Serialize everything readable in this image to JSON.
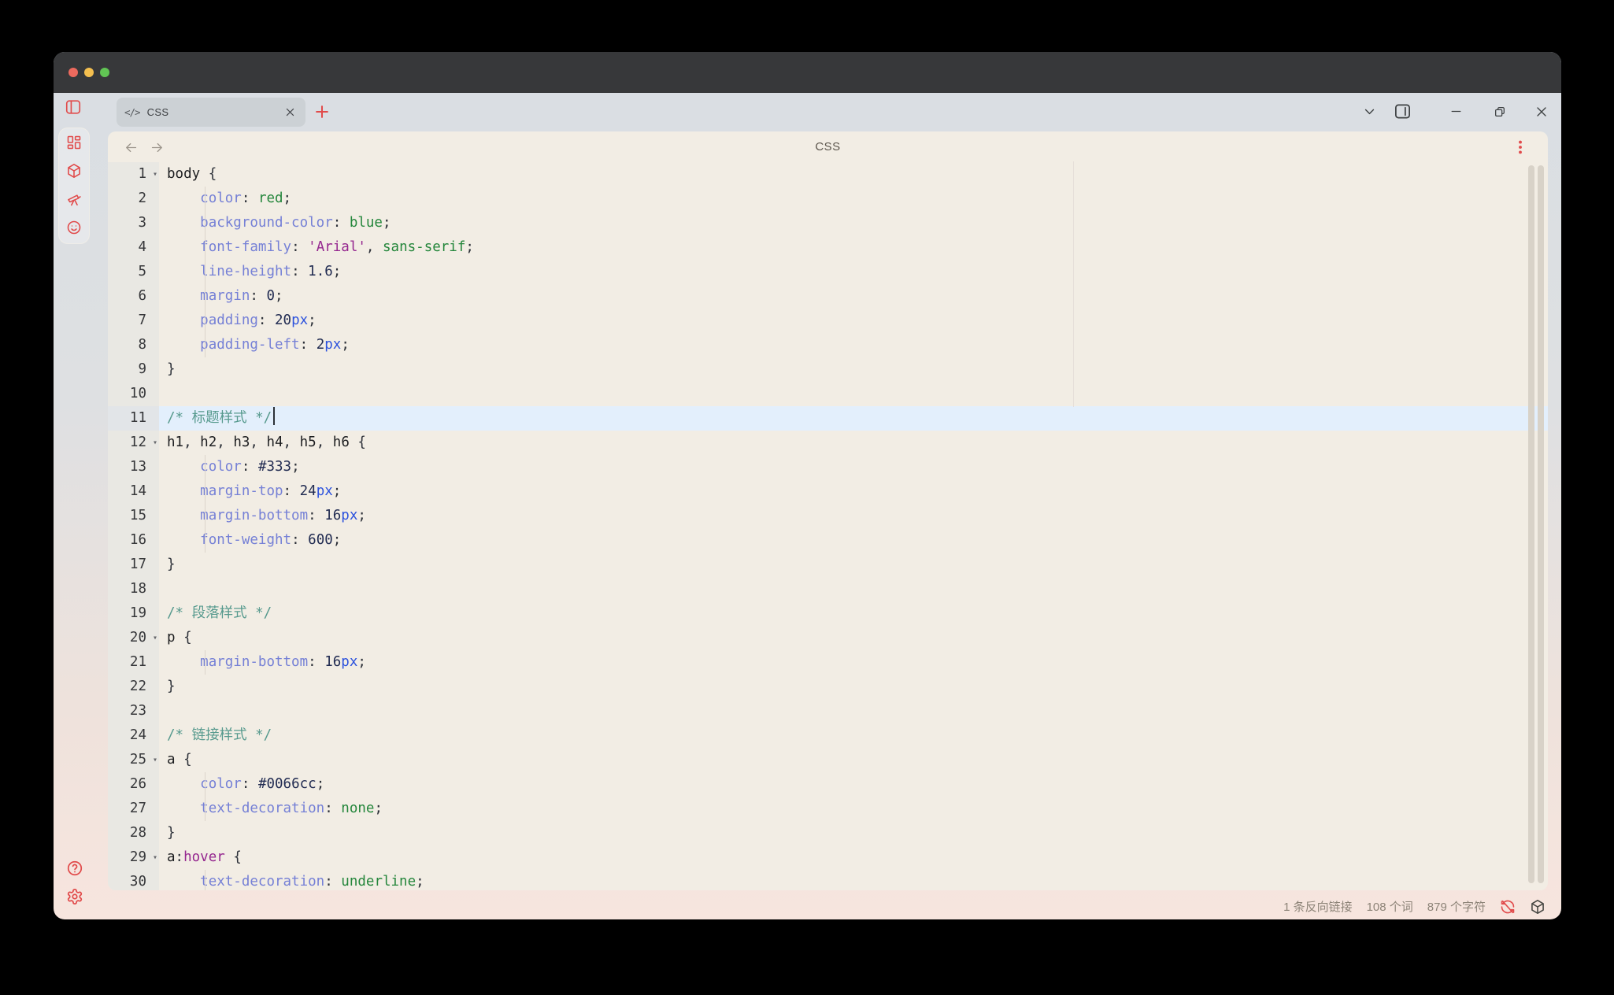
{
  "colors": {
    "accent": "#e14b4b",
    "titlebar": "#37383a",
    "editor_bg": "#f2ede4",
    "active_line": "#e3effc",
    "traffic_lights": [
      "#ed6a5e",
      "#f4bf4f",
      "#61c554"
    ]
  },
  "tabbar": {
    "tab": {
      "code_glyph": "</>",
      "label": "CSS"
    },
    "new_tab_label": "+"
  },
  "header": {
    "title": "CSS"
  },
  "editor": {
    "fold_marker": "▾",
    "token_colors": {
      "prop": "#7580d6",
      "kw": "#24863b",
      "str": "#95278f",
      "num": "#222c52",
      "unit": "#2c52dd",
      "comment": "#579a8e",
      "sel": "#1d1e20",
      "punct": "#2c3038",
      "pseudo": "#95278f"
    },
    "active_line_number": 11,
    "lines": [
      {
        "n": 1,
        "fold": true,
        "seg": [
          [
            "body",
            "sel"
          ],
          [
            " {",
            "punct"
          ]
        ]
      },
      {
        "n": 2,
        "seg": [
          [
            "    ",
            "plain"
          ],
          [
            "color",
            "prop"
          ],
          [
            ":",
            "punct"
          ],
          [
            " ",
            "plain"
          ],
          [
            "red",
            "kw"
          ],
          [
            ";",
            "punct"
          ]
        ]
      },
      {
        "n": 3,
        "seg": [
          [
            "    ",
            "plain"
          ],
          [
            "background-color",
            "prop"
          ],
          [
            ":",
            "punct"
          ],
          [
            " ",
            "plain"
          ],
          [
            "blue",
            "kw"
          ],
          [
            ";",
            "punct"
          ]
        ]
      },
      {
        "n": 4,
        "seg": [
          [
            "    ",
            "plain"
          ],
          [
            "font-family",
            "prop"
          ],
          [
            ":",
            "punct"
          ],
          [
            " ",
            "plain"
          ],
          [
            "'Arial'",
            "str"
          ],
          [
            ",",
            "punct"
          ],
          [
            " ",
            "plain"
          ],
          [
            "sans-serif",
            "kw"
          ],
          [
            ";",
            "punct"
          ]
        ]
      },
      {
        "n": 5,
        "seg": [
          [
            "    ",
            "plain"
          ],
          [
            "line-height",
            "prop"
          ],
          [
            ":",
            "punct"
          ],
          [
            " ",
            "plain"
          ],
          [
            "1.6",
            "num"
          ],
          [
            ";",
            "punct"
          ]
        ]
      },
      {
        "n": 6,
        "seg": [
          [
            "    ",
            "plain"
          ],
          [
            "margin",
            "prop"
          ],
          [
            ":",
            "punct"
          ],
          [
            " ",
            "plain"
          ],
          [
            "0",
            "num"
          ],
          [
            ";",
            "punct"
          ]
        ]
      },
      {
        "n": 7,
        "seg": [
          [
            "    ",
            "plain"
          ],
          [
            "padding",
            "prop"
          ],
          [
            ":",
            "punct"
          ],
          [
            " ",
            "plain"
          ],
          [
            "20",
            "num"
          ],
          [
            "px",
            "unit"
          ],
          [
            ";",
            "punct"
          ]
        ]
      },
      {
        "n": 8,
        "seg": [
          [
            "    ",
            "plain"
          ],
          [
            "padding-left",
            "prop"
          ],
          [
            ":",
            "punct"
          ],
          [
            " ",
            "plain"
          ],
          [
            "2",
            "num"
          ],
          [
            "px",
            "unit"
          ],
          [
            ";",
            "punct"
          ]
        ]
      },
      {
        "n": 9,
        "seg": [
          [
            "}",
            "punct"
          ]
        ]
      },
      {
        "n": 10,
        "seg": []
      },
      {
        "n": 11,
        "active": true,
        "cursor": true,
        "seg": [
          [
            "/* 标题样式 */",
            "comment"
          ]
        ]
      },
      {
        "n": 12,
        "fold": true,
        "seg": [
          [
            "h1",
            "sel"
          ],
          [
            ", ",
            "punct"
          ],
          [
            "h2",
            "sel"
          ],
          [
            ", ",
            "punct"
          ],
          [
            "h3",
            "sel"
          ],
          [
            ", ",
            "punct"
          ],
          [
            "h4",
            "sel"
          ],
          [
            ", ",
            "punct"
          ],
          [
            "h5",
            "sel"
          ],
          [
            ", ",
            "punct"
          ],
          [
            "h6",
            "sel"
          ],
          [
            " {",
            "punct"
          ]
        ]
      },
      {
        "n": 13,
        "seg": [
          [
            "    ",
            "plain"
          ],
          [
            "color",
            "prop"
          ],
          [
            ":",
            "punct"
          ],
          [
            " ",
            "plain"
          ],
          [
            "#333",
            "num"
          ],
          [
            ";",
            "punct"
          ]
        ]
      },
      {
        "n": 14,
        "seg": [
          [
            "    ",
            "plain"
          ],
          [
            "margin-top",
            "prop"
          ],
          [
            ":",
            "punct"
          ],
          [
            " ",
            "plain"
          ],
          [
            "24",
            "num"
          ],
          [
            "px",
            "unit"
          ],
          [
            ";",
            "punct"
          ]
        ]
      },
      {
        "n": 15,
        "seg": [
          [
            "    ",
            "plain"
          ],
          [
            "margin-bottom",
            "prop"
          ],
          [
            ":",
            "punct"
          ],
          [
            " ",
            "plain"
          ],
          [
            "16",
            "num"
          ],
          [
            "px",
            "unit"
          ],
          [
            ";",
            "punct"
          ]
        ]
      },
      {
        "n": 16,
        "seg": [
          [
            "    ",
            "plain"
          ],
          [
            "font-weight",
            "prop"
          ],
          [
            ":",
            "punct"
          ],
          [
            " ",
            "plain"
          ],
          [
            "600",
            "num"
          ],
          [
            ";",
            "punct"
          ]
        ]
      },
      {
        "n": 17,
        "seg": [
          [
            "}",
            "punct"
          ]
        ]
      },
      {
        "n": 18,
        "seg": []
      },
      {
        "n": 19,
        "seg": [
          [
            "/* 段落样式 */",
            "comment"
          ]
        ]
      },
      {
        "n": 20,
        "fold": true,
        "seg": [
          [
            "p",
            "sel"
          ],
          [
            " {",
            "punct"
          ]
        ]
      },
      {
        "n": 21,
        "seg": [
          [
            "    ",
            "plain"
          ],
          [
            "margin-bottom",
            "prop"
          ],
          [
            ":",
            "punct"
          ],
          [
            " ",
            "plain"
          ],
          [
            "16",
            "num"
          ],
          [
            "px",
            "unit"
          ],
          [
            ";",
            "punct"
          ]
        ]
      },
      {
        "n": 22,
        "seg": [
          [
            "}",
            "punct"
          ]
        ]
      },
      {
        "n": 23,
        "seg": []
      },
      {
        "n": 24,
        "seg": [
          [
            "/* 链接样式 */",
            "comment"
          ]
        ]
      },
      {
        "n": 25,
        "fold": true,
        "seg": [
          [
            "a",
            "sel"
          ],
          [
            " {",
            "punct"
          ]
        ]
      },
      {
        "n": 26,
        "seg": [
          [
            "    ",
            "plain"
          ],
          [
            "color",
            "prop"
          ],
          [
            ":",
            "punct"
          ],
          [
            " ",
            "plain"
          ],
          [
            "#0066cc",
            "num"
          ],
          [
            ";",
            "punct"
          ]
        ]
      },
      {
        "n": 27,
        "seg": [
          [
            "    ",
            "plain"
          ],
          [
            "text-decoration",
            "prop"
          ],
          [
            ":",
            "punct"
          ],
          [
            " ",
            "plain"
          ],
          [
            "none",
            "kw"
          ],
          [
            ";",
            "punct"
          ]
        ]
      },
      {
        "n": 28,
        "seg": [
          [
            "}",
            "punct"
          ]
        ]
      },
      {
        "n": 29,
        "fold": true,
        "seg": [
          [
            "a",
            "sel"
          ],
          [
            ":",
            "punct"
          ],
          [
            "hover",
            "pseudo"
          ],
          [
            " {",
            "punct"
          ]
        ]
      },
      {
        "n": 30,
        "seg": [
          [
            "    ",
            "plain"
          ],
          [
            "text-decoration",
            "prop"
          ],
          [
            ":",
            "punct"
          ],
          [
            " ",
            "plain"
          ],
          [
            "underline",
            "kw"
          ],
          [
            ";",
            "punct"
          ]
        ]
      }
    ]
  },
  "status_bar": {
    "backlinks": "1 条反向链接",
    "words": "108 个词",
    "chars": "879 个字符"
  }
}
